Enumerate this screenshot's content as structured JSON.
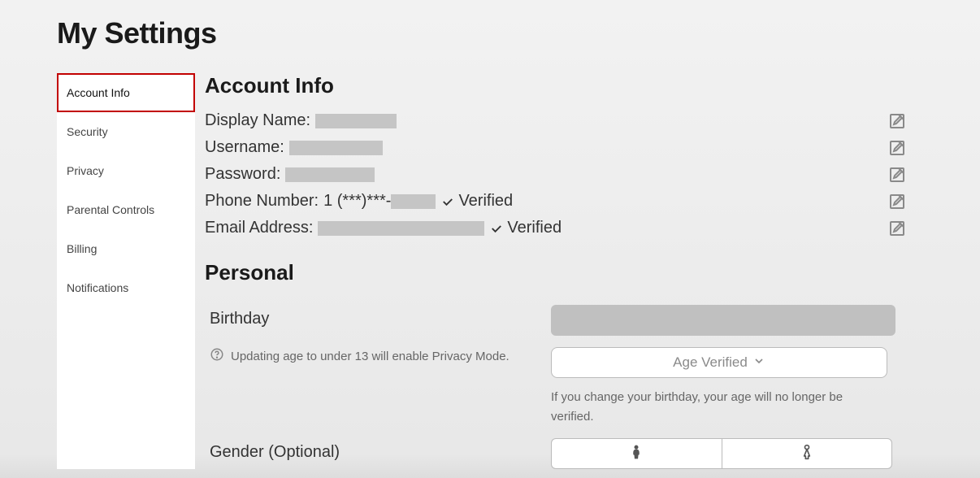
{
  "page_title": "My Settings",
  "sidebar": {
    "items": [
      {
        "label": "Account Info",
        "active": true
      },
      {
        "label": "Security",
        "active": false
      },
      {
        "label": "Privacy",
        "active": false
      },
      {
        "label": "Parental Controls",
        "active": false
      },
      {
        "label": "Billing",
        "active": false
      },
      {
        "label": "Notifications",
        "active": false
      }
    ]
  },
  "account_info": {
    "heading": "Account Info",
    "display_name_label": "Display Name:",
    "username_label": "Username:",
    "password_label": "Password:",
    "phone_label": "Phone Number:",
    "phone_value": "1 (***)***-",
    "email_label": "Email Address:",
    "verified_text": "Verified"
  },
  "personal": {
    "heading": "Personal",
    "birthday_label": "Birthday",
    "age_hint": "Updating age to under 13 will enable Privacy Mode.",
    "age_verified_label": "Age Verified",
    "age_change_note": "If you change your birthday, your age will no longer be verified.",
    "gender_label": "Gender (Optional)"
  }
}
